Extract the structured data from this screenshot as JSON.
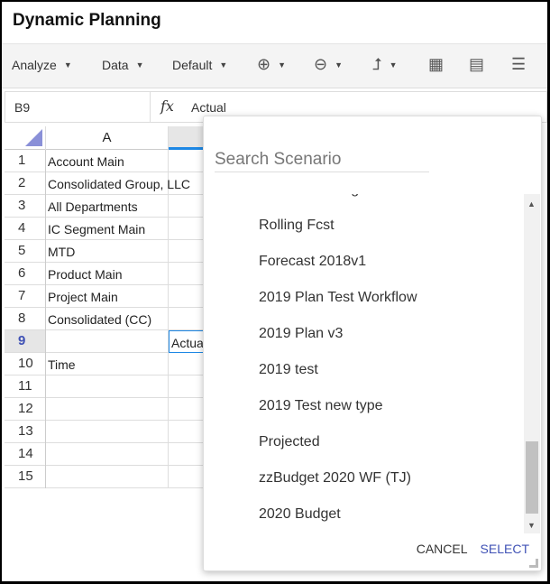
{
  "app": {
    "title": "Dynamic Planning"
  },
  "toolbar": {
    "analyze": "Analyze",
    "data": "Data",
    "default": "Default"
  },
  "formula": {
    "cell_ref": "B9",
    "fx": "fx",
    "value": "Actual"
  },
  "grid": {
    "col_a": "A",
    "rows": [
      {
        "n": "1",
        "a": "Account Main",
        "b": ""
      },
      {
        "n": "2",
        "a": "Consolidated Group, LLC",
        "b": ""
      },
      {
        "n": "3",
        "a": "All Departments",
        "b": ""
      },
      {
        "n": "4",
        "a": "IC Segment Main",
        "b": ""
      },
      {
        "n": "5",
        "a": "MTD",
        "b": ""
      },
      {
        "n": "6",
        "a": "Product Main",
        "b": ""
      },
      {
        "n": "7",
        "a": "Project Main",
        "b": ""
      },
      {
        "n": "8",
        "a": "Consolidated (CC)",
        "b": ""
      },
      {
        "n": "9",
        "a": "",
        "b": "Actual"
      },
      {
        "n": "10",
        "a": "Time",
        "b": ""
      },
      {
        "n": "11",
        "a": "",
        "b": ""
      },
      {
        "n": "12",
        "a": "",
        "b": ""
      },
      {
        "n": "13",
        "a": "",
        "b": ""
      },
      {
        "n": "14",
        "a": "",
        "b": ""
      },
      {
        "n": "15",
        "a": "",
        "b": ""
      }
    ],
    "selected_row": "9"
  },
  "popup": {
    "search_placeholder": "Search Scenario",
    "items": [
      "Rolling Fcst",
      "Forecast 2018v1",
      "2019 Plan Test Workflow",
      "2019 Plan v3",
      "2019 test",
      "2019 Test new type",
      "Projected",
      "zzBudget 2020 WF (TJ)",
      "2020 Budget"
    ],
    "scroll_position_percent": 80,
    "cancel": "CANCEL",
    "select": "SELECT"
  },
  "colors": {
    "accent": "#3f51b5",
    "selection": "#1e88e5"
  }
}
